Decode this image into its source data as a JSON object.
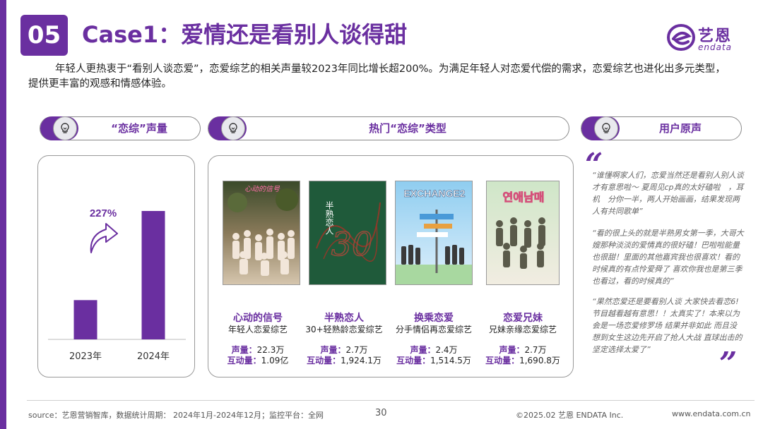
{
  "section_number": "05",
  "title": "Case1：爱情还是看别人谈得甜",
  "logo": {
    "cn": "艺恩",
    "en": "endata",
    "icon": "endata-logo-icon"
  },
  "intro": "年轻人更热衷于“看别人谈恋爱”，恋爱综艺的相关声量较2023年同比增长超200%。为满足年轻人对恋爱代偿的需求，恋爱综艺也进化出多元类型，提供更丰富的观感和情感体验。",
  "headers": {
    "volume": "“恋综”声量",
    "types": "热门“恋综”类型",
    "voices": "用户原声"
  },
  "header_icon": "lightbulb-icon",
  "chart_data": {
    "type": "bar",
    "categories": [
      "2023年",
      "2024年"
    ],
    "values": [
      100,
      327
    ],
    "annotation": "227%",
    "colors": {
      "bar": "#6a2fa0"
    }
  },
  "shows": [
    {
      "name": "心动的信号",
      "sub": "年轻人恋爱综艺",
      "volume_label": "声量：",
      "volume": "22.3万",
      "inter_label": "互动量：",
      "inter": "1.09亿",
      "poster_title": "心动的信号"
    },
    {
      "name": "半熟恋人",
      "sub": "30+轻熟龄恋爱综艺",
      "volume_label": "声量：",
      "volume": "2.7万",
      "inter_label": "互动量：",
      "inter": "1,924.1万",
      "poster_title": "半熟恋人"
    },
    {
      "name": "换乘恋爱",
      "sub": "分手情侣再恋爱综艺",
      "volume_label": "声量：",
      "volume": "2.4万",
      "inter_label": "互动量：",
      "inter": "1,514.5万",
      "poster_title": "EXCHANGE2"
    },
    {
      "name": "恋爱兄妹",
      "sub": "兄妹亲缘恋爱综艺",
      "volume_label": "声量：",
      "volume": "2.7万",
      "inter_label": "互动量：",
      "inter": "1,690.8万",
      "poster_title": "연애남매"
    }
  ],
  "quotes": [
    "“谁懂啊家人们，恋爱当然还是看别人别人谈才有意思啦～ 夏周见cp真的太好磕啦　，耳机　分你一半，两人开始画画，结果发现两人有共同歌单”",
    "“看的很上头的就是半熟男女第一季，大哥大嫂那种淡淡的爱情真的很好磕！巴啦啦能量也很甜！里面的其他嘉宾我也很喜欢！看的时候真的有点怜爱舜了 喜欢你我也是第三季也看过，看的时候真的”",
    "“果然恋爱还是要看别人谈 大家快去看恋6! 节目越看越有意思！！太真实了！本来以为会是一场恋爱修罗场 结果并非如此 而且没想到女生这边先开启了抢人大战 直球出击的坚定选择太爱了”"
  ],
  "footer": {
    "source": "source：艺恩营销智库，数据统计周期： 2024年1月-2024年12月；监控平台：全网",
    "page": "30",
    "copyright": "©2025.02  艺恩 ENDATA Inc.",
    "url": "www.endata.com.cn"
  }
}
